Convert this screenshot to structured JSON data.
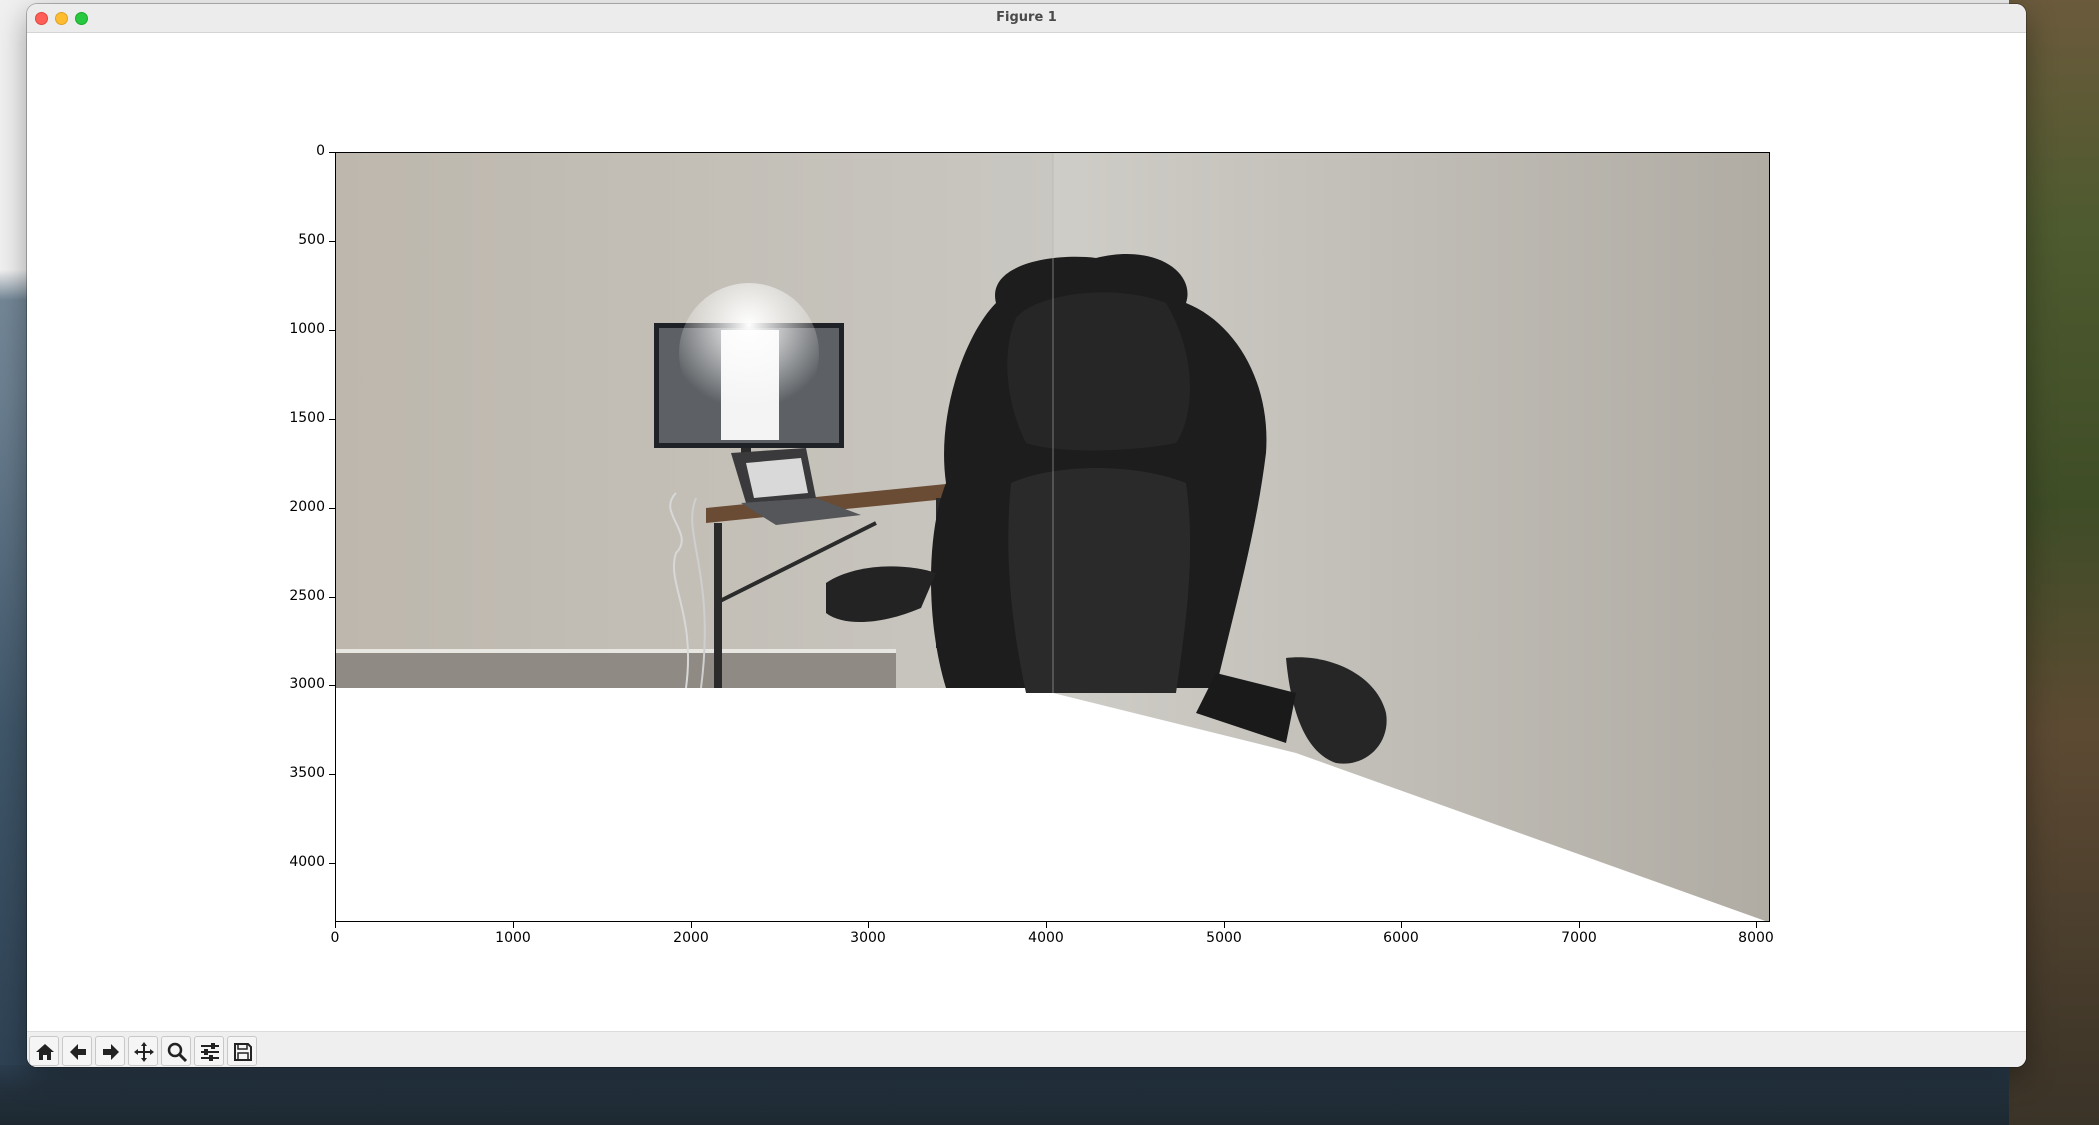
{
  "window": {
    "title": "Figure 1"
  },
  "chart_data": {
    "type": "image",
    "title": "",
    "xlabel": "",
    "ylabel": "",
    "xlim": [
      0,
      8064
    ],
    "ylim": [
      4320,
      0
    ],
    "x_ticks": [
      "0",
      "1000",
      "2000",
      "3000",
      "4000",
      "5000",
      "6000",
      "7000",
      "8000"
    ],
    "y_ticks": [
      "0",
      "500",
      "1000",
      "1500",
      "2000",
      "2500",
      "3000",
      "3500",
      "4000"
    ],
    "content": "stitched panorama photo of a desk with monitor, laptop and black office chair"
  },
  "toolbar": {
    "buttons": [
      {
        "name": "home-button",
        "icon": "home-icon"
      },
      {
        "name": "back-button",
        "icon": "arrow-left-icon"
      },
      {
        "name": "forward-button",
        "icon": "arrow-right-icon"
      },
      {
        "name": "pan-button",
        "icon": "move-icon"
      },
      {
        "name": "zoom-button",
        "icon": "magnifier-icon"
      },
      {
        "name": "configure-subplots-button",
        "icon": "sliders-icon"
      },
      {
        "name": "save-button",
        "icon": "floppy-disk-icon"
      }
    ]
  }
}
